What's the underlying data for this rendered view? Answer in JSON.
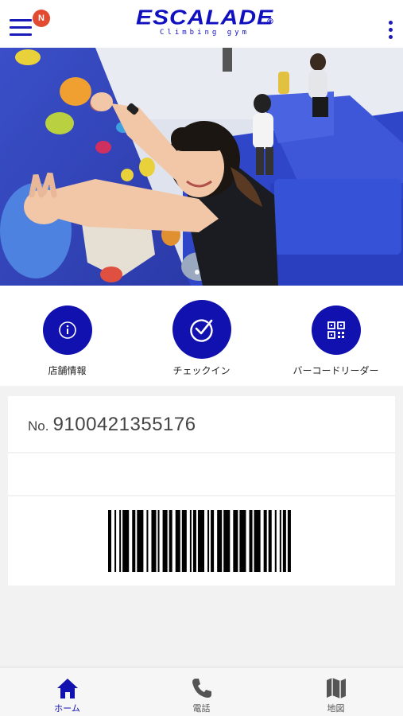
{
  "header": {
    "badge": "N",
    "logo_main": "ESCALADE",
    "logo_reg": "®",
    "logo_sub": "Climbing gym"
  },
  "hero": {
    "slide_indicator": "current-slide-1"
  },
  "actions": [
    {
      "label": "店舗情報",
      "icon": "info-icon"
    },
    {
      "label": "チェックイン",
      "icon": "checkmark-icon"
    },
    {
      "label": "バーコードリーダー",
      "icon": "qr-code-icon"
    }
  ],
  "member": {
    "no_prefix": "No.",
    "number": "9100421355176"
  },
  "tabs": [
    {
      "label": "ホーム",
      "icon": "home-icon",
      "active": true
    },
    {
      "label": "電話",
      "icon": "phone-icon",
      "active": false
    },
    {
      "label": "地図",
      "icon": "map-icon",
      "active": false
    }
  ],
  "colors": {
    "brand": "#1010c0",
    "badge": "#e24b2f",
    "active_tab": "#1111b0",
    "inactive_tab": "#555555"
  }
}
